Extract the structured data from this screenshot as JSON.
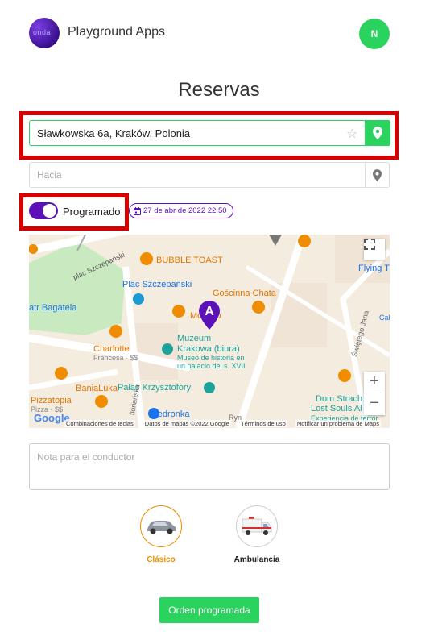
{
  "header": {
    "logo_text": "onda",
    "app_name": "Playground Apps",
    "avatar_initial": "N"
  },
  "page": {
    "title": "Reservas"
  },
  "route": {
    "from_value": "Sławkowska 6a, Kraków, Polonia",
    "to_placeholder": "Hacia"
  },
  "schedule": {
    "toggle_label": "Programado",
    "toggle_on": true,
    "date_text": "27 de abr de 2022 22:50"
  },
  "map": {
    "marker_label": "A",
    "places": {
      "plac_szczepanski_street": "plac Szczepański",
      "bubble_toast": "BUBBLE TOAST",
      "plac_szczepanski": "Plac Szczepański",
      "goscinna_chata": "Gościnna Chata",
      "flying_t": "Flying T",
      "bagatela": "atr Bagatela",
      "mokoo": "Mo      Oko",
      "charlotte": "Charlotte",
      "charlotte_sub": "Francesa · $$",
      "muzeum": "Muzeum",
      "muzeum2": "Krakowa (biura)",
      "muzeum_sub1": "Museo de historia en",
      "muzeum_sub2": "un palacio del s. XVII",
      "swietego_jana": "Świętego Jana",
      "banialuka": "BaniaLuka",
      "palac": "Pałac Krzysztofory",
      "pizzatopia": "Pizzatopia",
      "pizzatopia_sub": "Pizza · $$",
      "dom_strach": "Dom Strach",
      "lost_souls": "Lost Souls Al",
      "experiencia": "Experiencia de terror",
      "biedronka": "Biedronka",
      "ryn": "Ryn",
      "cal": "Cal",
      "florian": "floriańska",
      "zoom_in": "+",
      "zoom_out": "−"
    },
    "google": "Google",
    "footer": {
      "shortcuts": "Combinaciones de teclas",
      "data": "Datos de mapas ©2022 Google",
      "terms": "Términos de uso",
      "report": "Notificar un problema de Maps"
    }
  },
  "note": {
    "placeholder": "Nota para el conductor"
  },
  "vehicles": [
    {
      "label": "Clásico",
      "selected": true
    },
    {
      "label": "Ambulancia",
      "selected": false
    }
  ],
  "actions": {
    "order_label": "Orden programada"
  },
  "colors": {
    "accent_green": "#2ad35d",
    "accent_purple": "#5b10b8",
    "highlight_red": "#d50000",
    "selected_orange": "#f08c00"
  }
}
